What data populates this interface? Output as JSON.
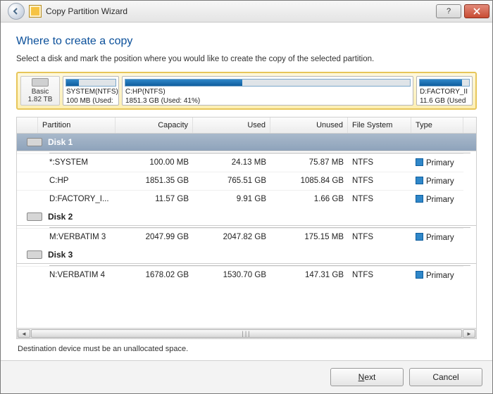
{
  "window": {
    "title": "Copy Partition Wizard"
  },
  "page": {
    "heading": "Where to create a copy",
    "instruction": "Select a disk and mark the position where you would like to create the copy of the selected partition.",
    "footer_note": "Destination device must be an unallocated space."
  },
  "diskmap": {
    "basic_label": "Basic",
    "basic_size": "1.82 TB",
    "parts": [
      {
        "line1": "SYSTEM(NTFS)",
        "line2": "100 MB (Used:",
        "fill_pct": 25
      },
      {
        "line1": "C:HP(NTFS)",
        "line2": "1851.3 GB (Used: 41%)",
        "fill_pct": 41
      },
      {
        "line1": "D:FACTORY_II",
        "line2": "11.6 GB (Used",
        "fill_pct": 86
      }
    ]
  },
  "table": {
    "headers": {
      "partition": "Partition",
      "capacity": "Capacity",
      "used": "Used",
      "unused": "Unused",
      "fs": "File System",
      "type": "Type"
    }
  },
  "disks": [
    {
      "name": "Disk 1",
      "active": true,
      "partitions": [
        {
          "name": "*:SYSTEM",
          "capacity": "100.00 MB",
          "used": "24.13 MB",
          "unused": "75.87 MB",
          "fs": "NTFS",
          "type": "Primary"
        },
        {
          "name": "C:HP",
          "capacity": "1851.35 GB",
          "used": "765.51 GB",
          "unused": "1085.84 GB",
          "fs": "NTFS",
          "type": "Primary"
        },
        {
          "name": "D:FACTORY_I...",
          "capacity": "11.57 GB",
          "used": "9.91 GB",
          "unused": "1.66 GB",
          "fs": "NTFS",
          "type": "Primary"
        }
      ]
    },
    {
      "name": "Disk 2",
      "active": false,
      "partitions": [
        {
          "name": "M:VERBATIM 3",
          "capacity": "2047.99 GB",
          "used": "2047.82 GB",
          "unused": "175.15 MB",
          "fs": "NTFS",
          "type": "Primary"
        }
      ]
    },
    {
      "name": "Disk 3",
      "active": false,
      "partitions": [
        {
          "name": "N:VERBATIM 4",
          "capacity": "1678.02 GB",
          "used": "1530.70 GB",
          "unused": "147.31 GB",
          "fs": "NTFS",
          "type": "Primary"
        }
      ]
    }
  ],
  "buttons": {
    "next": "Next",
    "cancel": "Cancel"
  }
}
